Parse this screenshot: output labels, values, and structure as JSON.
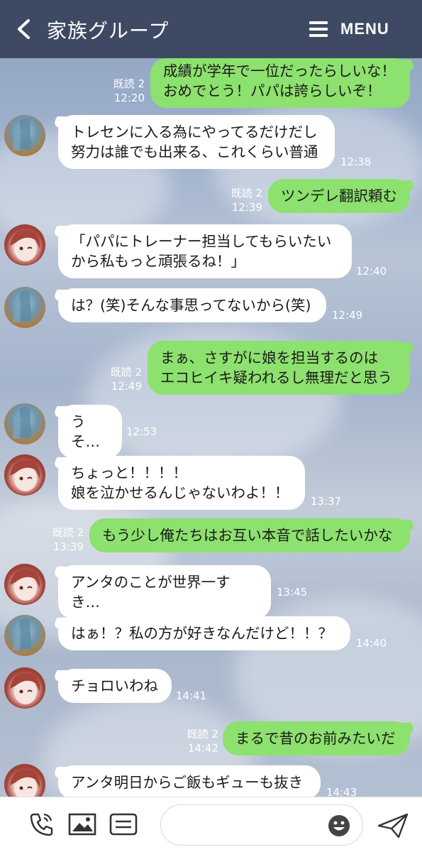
{
  "header": {
    "title": "家族グループ",
    "menu_label": "MENU"
  },
  "messages": [
    {
      "side": "right",
      "text": "成績が学年で一位だったらしいな！\nおめでとう！パパは誇らしいぞ！",
      "read": "既読 2",
      "time": "12:20"
    },
    {
      "side": "left",
      "avatar": "statue",
      "text": "トレセンに入る為にやってるだけだし\n努力は誰でも出来る、これくらい普通",
      "time": "12:38"
    },
    {
      "side": "right",
      "text": "ツンデレ翻訳頼む",
      "read": "既読 2",
      "time": "12:39"
    },
    {
      "side": "left",
      "avatar": "girl",
      "text": "「パパにトレーナー担当してもらいたい\nから私もっと頑張るね！」",
      "time": "12:40"
    },
    {
      "side": "left",
      "avatar": "statue",
      "text": "は？(笑)そんな事思ってないから(笑)",
      "time": "12:49"
    },
    {
      "side": "right",
      "text": "まぁ、さすがに娘を担当するのは\nエコヒイキ疑われるし無理だと思う",
      "read": "既読 2",
      "time": "12:49"
    },
    {
      "side": "left",
      "avatar": "statue",
      "text": "うそ…",
      "time": "12:53"
    },
    {
      "side": "left",
      "avatar": "girl",
      "text": "ちょっと！！！！\n娘を泣かせるんじゃないわよ！！",
      "time": "13:37"
    },
    {
      "side": "right",
      "text": "もう少し俺たちはお互い本音で話したいかな",
      "read": "既読 2",
      "time": "13:39"
    },
    {
      "side": "left",
      "avatar": "girl",
      "text": "アンタのことが世界一すき…",
      "time": "13:45"
    },
    {
      "side": "left",
      "avatar": "statue",
      "text": "はぁ！？私の方が好きなんだけど！！？",
      "time": "14:40"
    },
    {
      "side": "left",
      "avatar": "girl",
      "text": "チョロいわね",
      "time": "14:41"
    },
    {
      "side": "right",
      "text": "まるで昔のお前みたいだ",
      "read": "既読 2",
      "time": "14:42"
    },
    {
      "side": "left",
      "avatar": "girl",
      "text": "アンタ明日からご飯もギューも抜き",
      "time": "14:43"
    }
  ],
  "bottombar": {
    "icons": [
      "call-icon",
      "image-icon",
      "keyboard-icon",
      "emoji-icon",
      "send-icon"
    ],
    "input_placeholder": ""
  },
  "colors": {
    "header_bg": "#3e4a63",
    "my_bubble": "#8de16e",
    "their_bubble": "#ffffff"
  }
}
